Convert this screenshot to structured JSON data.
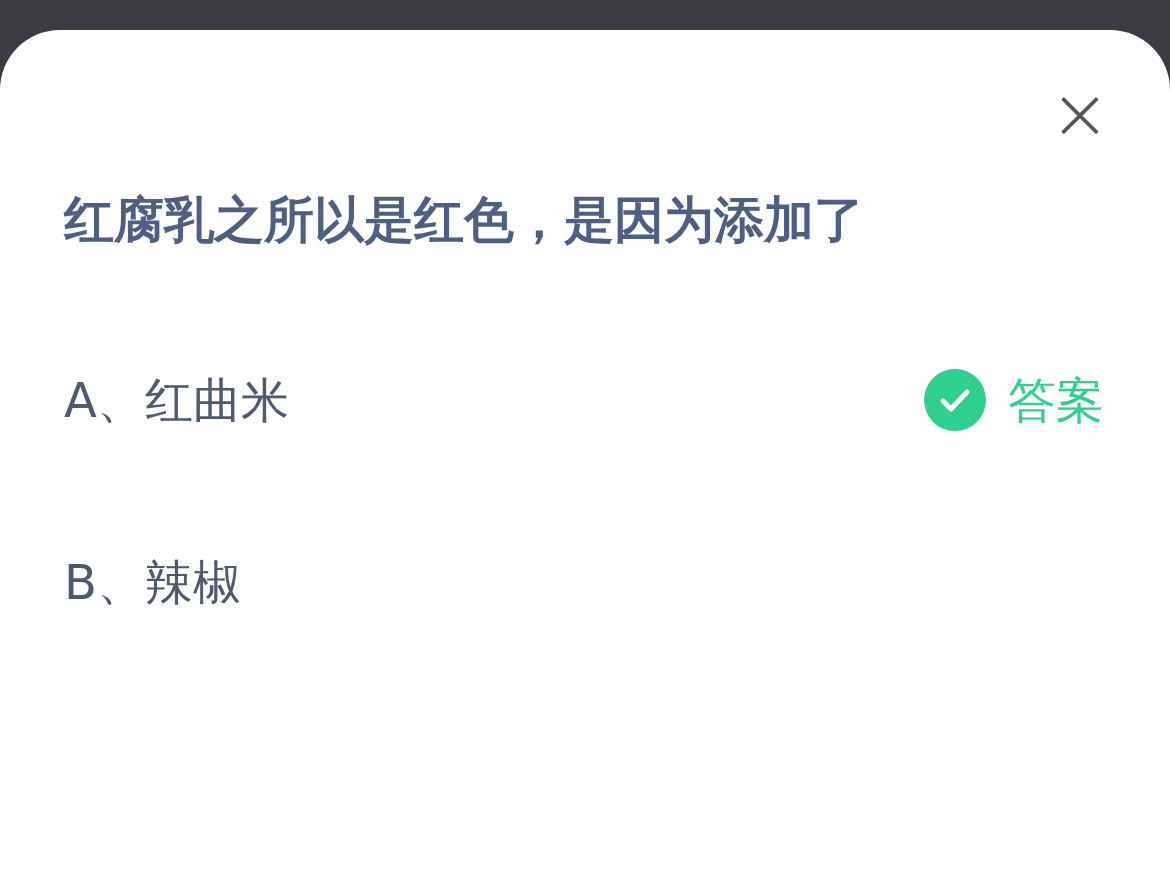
{
  "question": "红腐乳之所以是红色，是因为添加了",
  "close": "×",
  "options": [
    {
      "label": "A、红曲米",
      "answer_label": "答案"
    },
    {
      "label": "B、辣椒"
    }
  ]
}
